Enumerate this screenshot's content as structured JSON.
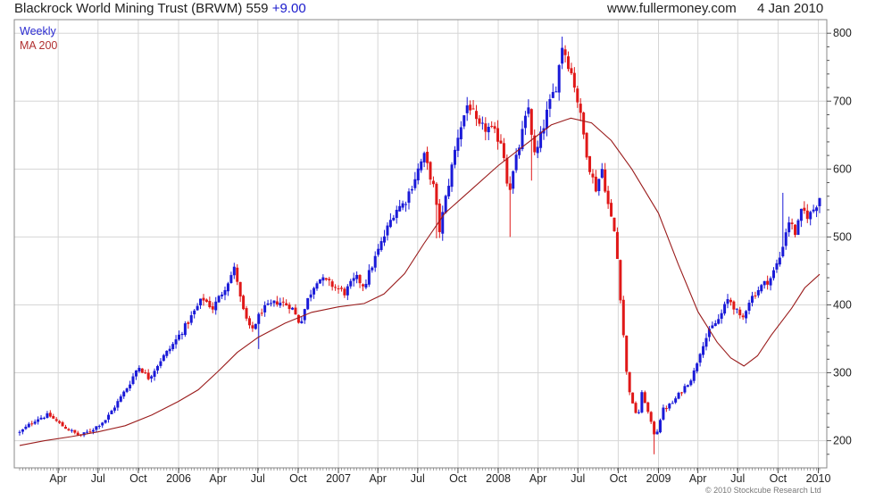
{
  "header": {
    "title": "Blackrock World Mining Trust (BRWM) 559",
    "change": "+9.00",
    "site": "www.fullermoney.com",
    "date": "4 Jan 2010"
  },
  "legend": {
    "weekly": "Weekly",
    "ma": "MA 200"
  },
  "copyright": "© 2010 Stockcube Research Ltd",
  "colors": {
    "up": "#1a1ad8",
    "down": "#e01818",
    "ma": "#9a1c1c",
    "grid": "#d6d6d6",
    "frame": "#888888"
  },
  "chart_data": {
    "type": "candlestick",
    "x_start": "2005-01-03",
    "x_end": "2010-01-04",
    "ylim": [
      160,
      820
    ],
    "y_ticks": [
      200,
      300,
      400,
      500,
      600,
      700,
      800
    ],
    "x_ticks": [
      {
        "label": "Apr",
        "date": "2005-04-01"
      },
      {
        "label": "Jul",
        "date": "2005-07-01"
      },
      {
        "label": "Oct",
        "date": "2005-10-01"
      },
      {
        "label": "2006",
        "date": "2006-01-01"
      },
      {
        "label": "Apr",
        "date": "2006-04-01"
      },
      {
        "label": "Jul",
        "date": "2006-07-01"
      },
      {
        "label": "Oct",
        "date": "2006-10-01"
      },
      {
        "label": "2007",
        "date": "2007-01-01"
      },
      {
        "label": "Apr",
        "date": "2007-04-01"
      },
      {
        "label": "Jul",
        "date": "2007-07-01"
      },
      {
        "label": "Oct",
        "date": "2007-10-01"
      },
      {
        "label": "2008",
        "date": "2008-01-01"
      },
      {
        "label": "Apr",
        "date": "2008-04-01"
      },
      {
        "label": "Jul",
        "date": "2008-07-01"
      },
      {
        "label": "Oct",
        "date": "2008-10-01"
      },
      {
        "label": "2009",
        "date": "2009-01-01"
      },
      {
        "label": "Apr",
        "date": "2009-04-01"
      },
      {
        "label": "Jul",
        "date": "2009-07-01"
      },
      {
        "label": "Oct",
        "date": "2009-10-01"
      },
      {
        "label": "2010",
        "date": "2010-01-01"
      }
    ],
    "series": [
      {
        "name": "Weekly",
        "style": "candlestick",
        "price_anchors": [
          [
            "2005-01-03",
            212
          ],
          [
            "2005-02-10",
            232
          ],
          [
            "2005-03-10",
            238
          ],
          [
            "2005-04-10",
            222
          ],
          [
            "2005-05-20",
            207
          ],
          [
            "2005-06-15",
            215
          ],
          [
            "2005-07-20",
            232
          ],
          [
            "2005-08-20",
            262
          ],
          [
            "2005-09-10",
            283
          ],
          [
            "2005-10-01",
            310
          ],
          [
            "2005-10-25",
            292
          ],
          [
            "2005-11-20",
            318
          ],
          [
            "2005-12-15",
            338
          ],
          [
            "2006-01-20",
            372
          ],
          [
            "2006-02-25",
            410
          ],
          [
            "2006-03-20",
            395
          ],
          [
            "2006-04-10",
            418
          ],
          [
            "2006-05-10",
            455
          ],
          [
            "2006-05-25",
            398
          ],
          [
            "2006-06-15",
            360
          ],
          [
            "2006-07-10",
            392
          ],
          [
            "2006-08-15",
            405
          ],
          [
            "2006-09-15",
            398
          ],
          [
            "2006-10-05",
            372
          ],
          [
            "2006-10-25",
            412
          ],
          [
            "2006-11-15",
            440
          ],
          [
            "2006-12-15",
            430
          ],
          [
            "2007-01-15",
            418
          ],
          [
            "2007-02-10",
            440
          ],
          [
            "2007-03-01",
            428
          ],
          [
            "2007-03-20",
            460
          ],
          [
            "2007-04-15",
            500
          ],
          [
            "2007-05-10",
            540
          ],
          [
            "2007-06-01",
            550
          ],
          [
            "2007-06-20",
            580
          ],
          [
            "2007-07-15",
            620
          ],
          [
            "2007-08-05",
            578
          ],
          [
            "2007-08-20",
            510
          ],
          [
            "2007-09-10",
            580
          ],
          [
            "2007-10-01",
            650
          ],
          [
            "2007-10-25",
            700
          ],
          [
            "2007-11-15",
            660
          ],
          [
            "2007-12-10",
            660
          ],
          [
            "2008-01-10",
            640
          ],
          [
            "2008-01-25",
            565
          ],
          [
            "2008-02-20",
            640
          ],
          [
            "2008-03-10",
            690
          ],
          [
            "2008-03-25",
            615
          ],
          [
            "2008-04-20",
            680
          ],
          [
            "2008-05-15",
            730
          ],
          [
            "2008-05-25",
            785
          ],
          [
            "2008-06-10",
            755
          ],
          [
            "2008-06-25",
            720
          ],
          [
            "2008-07-10",
            665
          ],
          [
            "2008-07-25",
            610
          ],
          [
            "2008-08-10",
            570
          ],
          [
            "2008-08-25",
            600
          ],
          [
            "2008-09-10",
            540
          ],
          [
            "2008-09-25",
            500
          ],
          [
            "2008-10-10",
            380
          ],
          [
            "2008-10-20",
            300
          ],
          [
            "2008-11-01",
            255
          ],
          [
            "2008-11-15",
            235
          ],
          [
            "2008-11-25",
            272
          ],
          [
            "2008-12-15",
            225
          ],
          [
            "2008-12-25",
            205
          ],
          [
            "2009-01-10",
            245
          ],
          [
            "2009-02-01",
            255
          ],
          [
            "2009-02-25",
            275
          ],
          [
            "2009-03-20",
            295
          ],
          [
            "2009-04-10",
            340
          ],
          [
            "2009-05-01",
            365
          ],
          [
            "2009-05-20",
            380
          ],
          [
            "2009-06-10",
            410
          ],
          [
            "2009-06-25",
            395
          ],
          [
            "2009-07-10",
            375
          ],
          [
            "2009-07-25",
            405
          ],
          [
            "2009-08-20",
            425
          ],
          [
            "2009-09-15",
            440
          ],
          [
            "2009-10-05",
            470
          ],
          [
            "2009-10-25",
            525
          ],
          [
            "2009-11-10",
            505
          ],
          [
            "2009-11-25",
            540
          ],
          [
            "2009-12-10",
            530
          ],
          [
            "2009-12-25",
            545
          ],
          [
            "2010-01-04",
            559
          ]
        ],
        "spikes": [
          [
            "2006-07-01",
            335,
            "low"
          ],
          [
            "2007-08-10",
            498,
            "low"
          ],
          [
            "2008-01-25",
            500,
            "low"
          ],
          [
            "2008-03-20",
            583,
            "low"
          ],
          [
            "2008-05-25",
            795,
            "high"
          ],
          [
            "2008-12-20",
            180,
            "low"
          ],
          [
            "2009-10-15",
            565,
            "high"
          ]
        ]
      },
      {
        "name": "MA 200",
        "style": "line",
        "points": [
          [
            "2005-01-03",
            193
          ],
          [
            "2005-03-01",
            200
          ],
          [
            "2005-05-01",
            206
          ],
          [
            "2005-07-01",
            213
          ],
          [
            "2005-09-01",
            222
          ],
          [
            "2005-11-01",
            238
          ],
          [
            "2006-01-01",
            258
          ],
          [
            "2006-02-15",
            275
          ],
          [
            "2006-04-01",
            302
          ],
          [
            "2006-05-15",
            330
          ],
          [
            "2006-07-01",
            352
          ],
          [
            "2006-09-01",
            373
          ],
          [
            "2006-11-01",
            389
          ],
          [
            "2007-01-01",
            397
          ],
          [
            "2007-03-01",
            402
          ],
          [
            "2007-04-15",
            416
          ],
          [
            "2007-06-01",
            446
          ],
          [
            "2007-07-15",
            490
          ],
          [
            "2007-09-01",
            535
          ],
          [
            "2007-11-01",
            570
          ],
          [
            "2008-01-01",
            605
          ],
          [
            "2008-03-01",
            635
          ],
          [
            "2008-05-01",
            665
          ],
          [
            "2008-06-15",
            675
          ],
          [
            "2008-08-01",
            668
          ],
          [
            "2008-09-15",
            642
          ],
          [
            "2008-11-01",
            600
          ],
          [
            "2009-01-01",
            535
          ],
          [
            "2009-02-15",
            460
          ],
          [
            "2009-04-01",
            390
          ],
          [
            "2009-05-15",
            345
          ],
          [
            "2009-06-15",
            322
          ],
          [
            "2009-07-15",
            310
          ],
          [
            "2009-08-15",
            325
          ],
          [
            "2009-09-15",
            355
          ],
          [
            "2009-11-01",
            395
          ],
          [
            "2009-12-01",
            425
          ],
          [
            "2010-01-04",
            445
          ]
        ]
      }
    ]
  }
}
